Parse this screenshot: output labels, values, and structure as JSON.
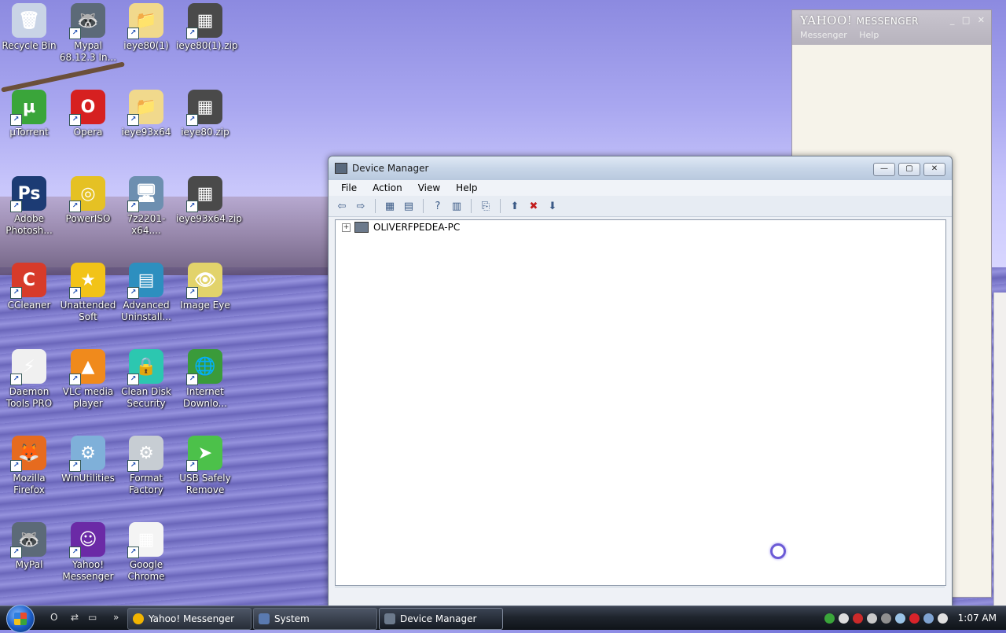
{
  "desktop": {
    "icons": [
      {
        "label": "Recycle Bin",
        "glyph": "🗑",
        "icon": "recycle-bin-icon",
        "color": "#c9d4e6"
      },
      {
        "label": "Mypal 68.12.3 In...",
        "glyph": "🦝",
        "icon": "raccoon-icon",
        "color": "#5c6a78"
      },
      {
        "label": "ieye80(1)",
        "glyph": "📁",
        "icon": "folder-icon",
        "color": "#f1d98c"
      },
      {
        "label": "ieye80(1).zip",
        "glyph": "▦",
        "icon": "zip-archive-icon",
        "color": "#4a4a4a"
      },
      {
        "label": "µTorrent",
        "glyph": "µ",
        "icon": "utorrent-icon",
        "color": "#3aa53a"
      },
      {
        "label": "Opera",
        "glyph": "O",
        "icon": "opera-icon",
        "color": "#d62020"
      },
      {
        "label": "ieye93x64",
        "glyph": "📁",
        "icon": "folder-icon",
        "color": "#f1d98c"
      },
      {
        "label": "ieye80.zip",
        "glyph": "▦",
        "icon": "zip-archive-icon",
        "color": "#4a4a4a"
      },
      {
        "label": "Adobe Photosh...",
        "glyph": "Ps",
        "icon": "photoshop-icon",
        "color": "#1c3b74"
      },
      {
        "label": "PowerISO",
        "glyph": "◎",
        "icon": "cd-disc-icon",
        "color": "#e5c124"
      },
      {
        "label": "7z2201-x64....",
        "glyph": "🖥",
        "icon": "installer-icon",
        "color": "#6d8fb0"
      },
      {
        "label": "ieye93x64.zip",
        "glyph": "▦",
        "icon": "zip-archive-icon",
        "color": "#4a4a4a"
      },
      {
        "label": "CCleaner",
        "glyph": "C",
        "icon": "ccleaner-icon",
        "color": "#d73b2a"
      },
      {
        "label": "Unattended Soft",
        "glyph": "★",
        "icon": "star-icon",
        "color": "#f2c318"
      },
      {
        "label": "Advanced Uninstall...",
        "glyph": "▤",
        "icon": "uninstaller-icon",
        "color": "#2d8fbf"
      },
      {
        "label": "Image Eye",
        "glyph": "👁",
        "icon": "eye-icon",
        "color": "#e2d36b"
      },
      {
        "label": "Daemon Tools PRO",
        "glyph": "⚡",
        "icon": "lightning-icon",
        "color": "#f0f0f0"
      },
      {
        "label": "VLC media player",
        "glyph": "▲",
        "icon": "vlc-cone-icon",
        "color": "#f08a1c"
      },
      {
        "label": "Clean Disk Security",
        "glyph": "🔒",
        "icon": "disk-lock-icon",
        "color": "#2cc7b0"
      },
      {
        "label": "Internet Downlo...",
        "glyph": "🌐",
        "icon": "globe-download-icon",
        "color": "#3a9b3a"
      },
      {
        "label": "Mozilla Firefox",
        "glyph": "🦊",
        "icon": "firefox-icon",
        "color": "#e66b1f"
      },
      {
        "label": "WinUtilities",
        "glyph": "⚙",
        "icon": "winutilities-icon",
        "color": "#7fb0d9"
      },
      {
        "label": "Format Factory",
        "glyph": "⚙",
        "icon": "format-factory-icon",
        "color": "#c7cdd3"
      },
      {
        "label": "USB Safely Remove",
        "glyph": "➤",
        "icon": "usb-icon",
        "color": "#4cc14a"
      },
      {
        "label": "MyPal",
        "glyph": "🦝",
        "icon": "raccoon-icon",
        "color": "#5c6a78"
      },
      {
        "label": "Yahoo! Messenger",
        "glyph": "☺",
        "icon": "yahoo-messenger-icon",
        "color": "#6b2aa6"
      },
      {
        "label": "Google Chrome",
        "glyph": "▦",
        "icon": "document-icon",
        "color": "#f4f4f4"
      }
    ]
  },
  "yahoo_window": {
    "title_brand": "YAHOO!",
    "title_product": "MESSENGER",
    "menu": [
      "Messenger",
      "Help"
    ]
  },
  "device_manager": {
    "title": "Device Manager",
    "menu": [
      "File",
      "Action",
      "View",
      "Help"
    ],
    "toolbar": [
      "back-arrow-icon",
      "forward-arrow-icon",
      "show-hide-tree-icon",
      "properties-icon",
      "help-icon",
      "action-pane-icon",
      "scan-hardware-icon",
      "update-driver-icon",
      "uninstall-device-icon",
      "disable-device-icon"
    ],
    "tree_root": "OLIVERFPEDEA-PC"
  },
  "taskbar": {
    "buttons": [
      {
        "label": "Yahoo! Messenger",
        "icon": "yahoo-smiley-icon",
        "color": "#f2b400"
      },
      {
        "label": "System",
        "icon": "system-icon",
        "color": "#5a7ab0"
      },
      {
        "label": "Device Manager",
        "icon": "device-manager-icon",
        "color": "#6c7a8c"
      }
    ],
    "clock": "1:07 AM"
  }
}
